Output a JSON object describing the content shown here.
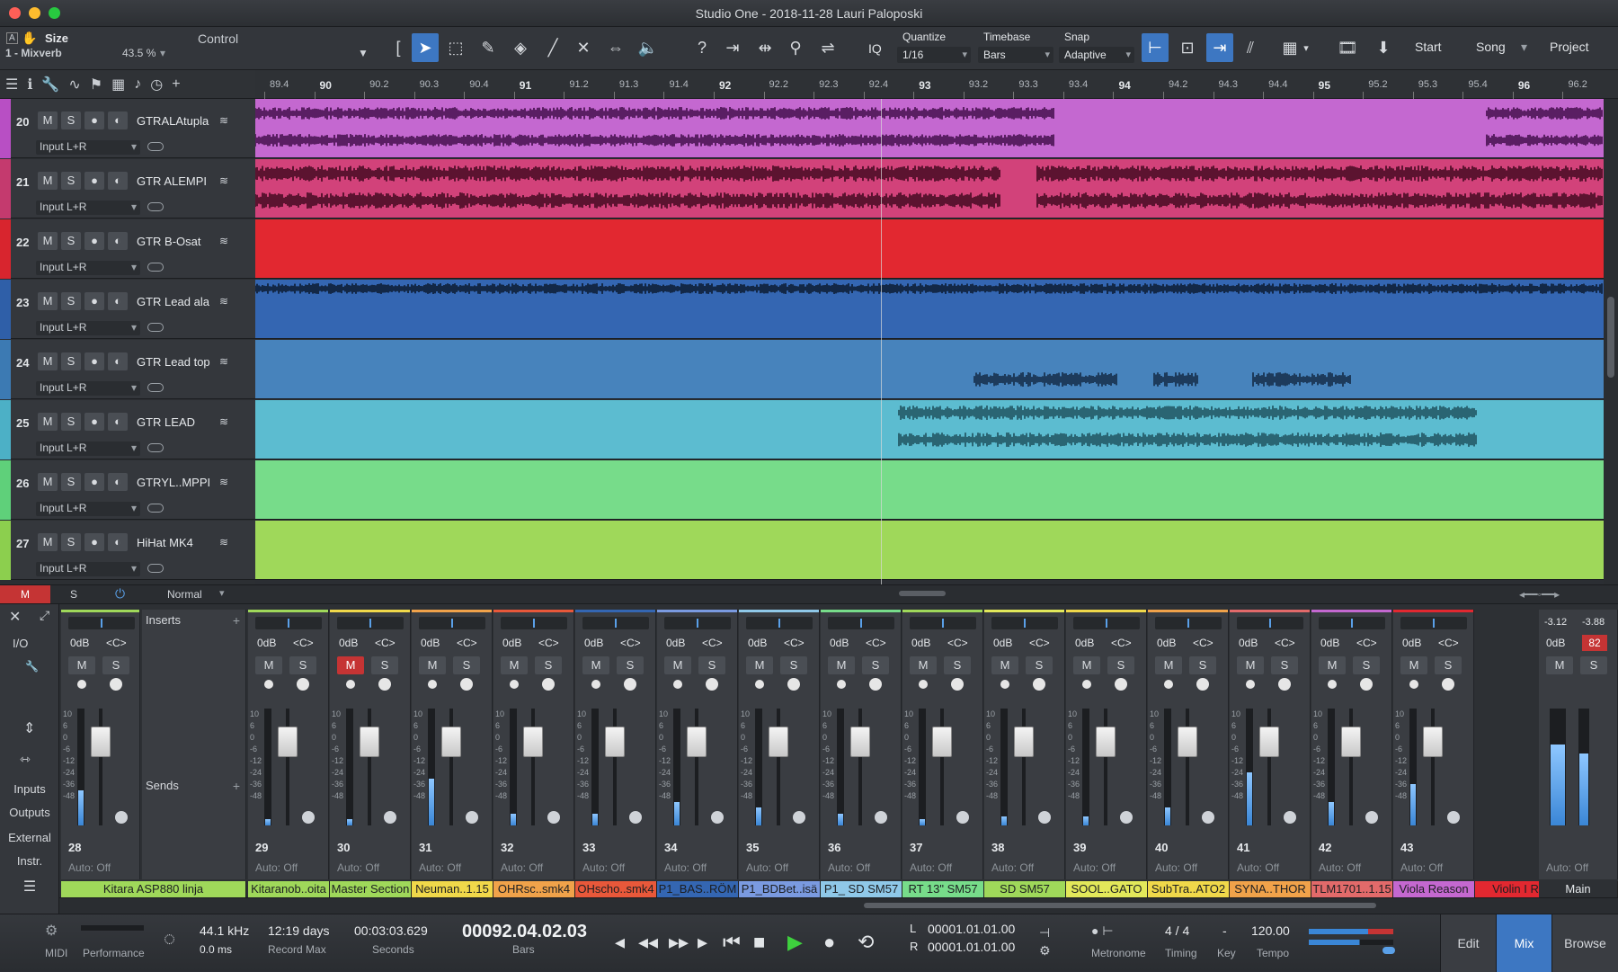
{
  "window": {
    "title": "Studio One - 2018-11-28 Lauri Paloposki"
  },
  "toolbar": {
    "inspector_a": "A",
    "size_label": "Size",
    "control_label": "Control",
    "device": "1 - Mixverb",
    "zoom": "43.5 %",
    "iq": "IQ",
    "quantize_label": "Quantize",
    "quantize_value": "1/16",
    "timebase_label": "Timebase",
    "timebase_value": "Bars",
    "snap_label": "Snap",
    "snap_value": "Adaptive",
    "start": "Start",
    "song": "Song",
    "project": "Project"
  },
  "ruler": {
    "labels": [
      "89.4",
      "90",
      "90.2",
      "90.3",
      "90.4",
      "91",
      "91.2",
      "91.3",
      "91.4",
      "92",
      "92.2",
      "92.3",
      "92.4",
      "93",
      "93.2",
      "93.3",
      "93.4",
      "94",
      "94.2",
      "94.3",
      "94.4",
      "95",
      "95.2",
      "95.3",
      "95.4",
      "96",
      "96.2"
    ],
    "major": [
      "90",
      "91",
      "92",
      "93",
      "94",
      "95",
      "96"
    ]
  },
  "tracks": [
    {
      "num": "20",
      "name": "GTRALAtupla",
      "input": "Input L+R",
      "color": "#b84fc4",
      "lane": "#c468d0"
    },
    {
      "num": "21",
      "name": "GTR ALEMPI",
      "input": "Input L+R",
      "color": "#c43a6e",
      "lane": "#d2427a"
    },
    {
      "num": "22",
      "name": "GTR B-Osat",
      "input": "Input L+R",
      "color": "#d8252e",
      "lane": "#e22830"
    },
    {
      "num": "23",
      "name": "GTR Lead ala",
      "input": "Input L+R",
      "color": "#2f5fa8",
      "lane": "#3466b2"
    },
    {
      "num": "24",
      "name": "GTR Lead top",
      "input": "Input L+R",
      "color": "#3c7ab3",
      "lane": "#4783bc"
    },
    {
      "num": "25",
      "name": "GTR LEAD",
      "input": "Input L+R",
      "color": "#4cb0c6",
      "lane": "#5cbcd0"
    },
    {
      "num": "26",
      "name": "GTRYL..MPPI",
      "input": "Input L+R",
      "color": "#5fd07a",
      "lane": "#77dc8a"
    },
    {
      "num": "27",
      "name": "HiHat MK4",
      "input": "Input L+R",
      "color": "#8ccf4e",
      "lane": "#9fd85a"
    }
  ],
  "track_buttons": {
    "m": "M",
    "s": "S"
  },
  "arr_bottom": {
    "m": "M",
    "s": "S",
    "mode": "Normal"
  },
  "mixer": {
    "nav": [
      "I/O",
      "Inputs",
      "Outputs",
      "External",
      "Instr."
    ],
    "inserts": "Inserts",
    "sends": "Sends",
    "odb": "0dB",
    "center": "<C>",
    "auto": "Auto: Off",
    "main_label": "Main",
    "main_peak_l": "-3.12",
    "main_peak_r": "-3.88",
    "main_clip": "82",
    "scale": [
      "10",
      "6",
      "0",
      "-6",
      "-12",
      "-24",
      "-36",
      "-48"
    ],
    "channels": [
      {
        "num": "28",
        "name": "Kitaranob..oita",
        "color": "#9fd85a",
        "level": 0.3,
        "mute": false
      },
      {
        "num": "29",
        "name": "Master Section",
        "color": "#9fd85a",
        "level": 0.05,
        "mute": false
      },
      {
        "num": "30",
        "name": "Neuman..1.15",
        "color": "#f0d84a",
        "level": 0.05,
        "mute": true
      },
      {
        "num": "31",
        "name": "OHRsc..smk4",
        "color": "#f0a24a",
        "level": 0.4,
        "mute": false
      },
      {
        "num": "32",
        "name": "OHscho..smk4",
        "color": "#e8583a",
        "level": 0.1,
        "mute": false
      },
      {
        "num": "33",
        "name": "P1_BAS..RÖM",
        "color": "#3466b2",
        "level": 0.1,
        "mute": false
      },
      {
        "num": "34",
        "name": "P1_BDBet..isä",
        "color": "#7a9ae0",
        "level": 0.2,
        "mute": false
      },
      {
        "num": "35",
        "name": "P1_ SD SM57",
        "color": "#8fc8e8",
        "level": 0.15,
        "mute": false
      },
      {
        "num": "36",
        "name": "RT 13\" SM57",
        "color": "#77dc8a",
        "level": 0.1,
        "mute": false
      },
      {
        "num": "37",
        "name": "SD SM57",
        "color": "#9fd85a",
        "level": 0.05,
        "mute": false
      },
      {
        "num": "38",
        "name": "SOOL..GATO",
        "color": "#e2e85a",
        "level": 0.08,
        "mute": false
      },
      {
        "num": "39",
        "name": "SubTra..ATO2",
        "color": "#f0d84a",
        "level": 0.08,
        "mute": false
      },
      {
        "num": "40",
        "name": "SYNA..THOR",
        "color": "#f0a24a",
        "level": 0.15,
        "mute": false
      },
      {
        "num": "41",
        "name": "TLM1701..1.15",
        "color": "#e26a6a",
        "level": 0.45,
        "mute": false
      },
      {
        "num": "42",
        "name": "Viola Reason",
        "color": "#c468d0",
        "level": 0.2,
        "mute": false
      },
      {
        "num": "43",
        "name": "Violin I R",
        "color": "#e22830",
        "level": 0.35,
        "mute": false
      }
    ],
    "first": {
      "name": "Kitara ASP880 linja",
      "num": "28"
    }
  },
  "transport": {
    "midi": "MIDI",
    "performance": "Performance",
    "samplerate": "44.1 kHz",
    "latency": "0.0 ms",
    "record_days": "12:19 days",
    "record_max": "Record Max",
    "seconds_val": "00:03:03.629",
    "seconds_lbl": "Seconds",
    "bars_val": "00092.04.02.03",
    "bars_lbl": "Bars",
    "loop_l_key": "L",
    "loop_l": "00001.01.01.00",
    "loop_r_key": "R",
    "loop_r": "00001.01.01.00",
    "metronome": "Metronome",
    "timing_val": "4 / 4",
    "timing_lbl": "Timing",
    "key_val": "-",
    "key_lbl": "Key",
    "tempo_val": "120.00",
    "tempo_lbl": "Tempo",
    "tabs": [
      "Edit",
      "Mix",
      "Browse"
    ]
  }
}
